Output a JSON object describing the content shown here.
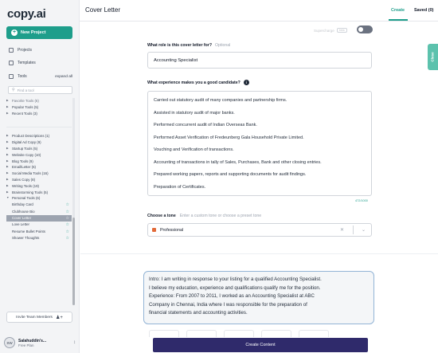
{
  "app": {
    "logo": "copy.ai"
  },
  "sidebar": {
    "new_project": "New Project",
    "links": [
      {
        "label": "Projects",
        "icon": "grid-icon"
      },
      {
        "label": "Templates",
        "icon": "document-icon"
      }
    ],
    "tools_label": "Tools",
    "expand_all": "expand all",
    "find_placeholder": "Find a tool",
    "tool_categories_top": [
      "Favorite Tools (6)",
      "Popular Tools (5)",
      "Recent Tools (3)"
    ],
    "tool_categories": [
      "Product Descriptions (1)",
      "Digital Ad Copy (9)",
      "Startup Tools (5)",
      "Website Copy (10)",
      "Blog Tools (9)",
      "Email/Letter (6)",
      "Social Media Tools (16)",
      "Sales Copy (8)",
      "Writing Tools (19)",
      "Brainstorming Tools (5)",
      "Personal Tools (6)"
    ],
    "personal_tools": [
      "Birthday Card",
      "Clubhouse Bio",
      "Cover Letter",
      "Love Letter",
      "Resume Bullet Points",
      "Shower Thoughts"
    ],
    "active_tool": "Cover Letter",
    "invite": "Invite Team Members",
    "user": {
      "initials": "SW",
      "name": "Salahuddin's...",
      "plan": "Free Plan"
    }
  },
  "header": {
    "title": "Cover Letter",
    "tabs": {
      "create": "Create",
      "saved": "Saved (0)"
    }
  },
  "form": {
    "supercharge": "Supercharge",
    "beta": "beta",
    "role_label": "What role is this cover letter for?",
    "role_optional": "Optional",
    "role_value": "Accounting Specialist",
    "experience_label": "What experience makes you a good candidate?",
    "experience_lines": [
      "Carried out statutory audit of many companies and partnership firms.",
      "Assisted in statutory audit of major banks.",
      "Performed concurrent audit of Indian Overseas Bank.",
      "Performed Asset Verification of Fredeunberg Gala Household Private Limited.",
      "Vouching and Verification of transactions.",
      "Accounting of transactions in tally of Sales, Purchases, Bank and other closing entries.",
      "Prepared working papers, reports and supporting documents for audit findings.",
      "Preparation of Certificates."
    ],
    "char_count": "472/1000",
    "tone_label": "Choose a tone",
    "tone_placeholder": "Enter a custom tone or choose a preset tone",
    "tone_value": "Professional",
    "create_button": "Create Content",
    "close_tab": "Close"
  },
  "output": {
    "lines": [
      "Intro: I am writing in response to your listing for a qualified Accounting Specialist.",
      "I believe my education, experience and qualifications qualify me for the position.",
      "Experience: From 2007 to 2011, I worked as an Accounting Specialist at ABC",
      "Company in Chennai, India where I was responsible for the preparation of",
      "financial statements and accounting activities."
    ]
  },
  "colors": {
    "accent": "#1e9e8b",
    "button": "#2f2a6b",
    "close_tab": "#5cc2ad"
  }
}
